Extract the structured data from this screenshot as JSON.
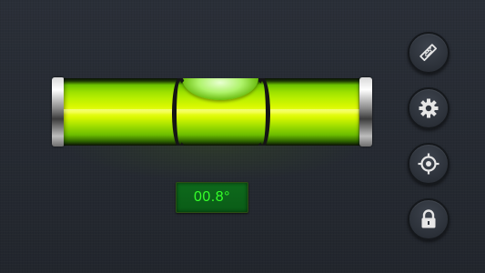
{
  "level": {
    "angle_readout": "00.8°"
  },
  "side_buttons": [
    {
      "icon": "ruler-pencil-icon"
    },
    {
      "icon": "gear-icon"
    },
    {
      "icon": "crosshair-icon"
    },
    {
      "icon": "lock-icon"
    }
  ],
  "colors": {
    "accent_green": "#35ff2a",
    "liquid": "#b9ef00",
    "background": "#262b33"
  }
}
